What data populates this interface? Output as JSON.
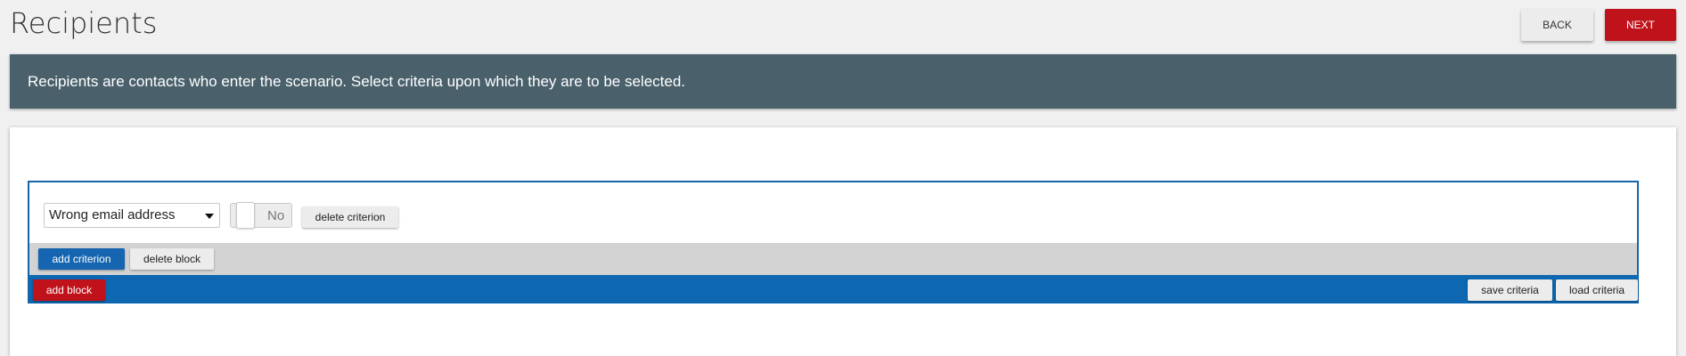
{
  "header": {
    "title": "Recipients",
    "back_label": "BACK",
    "next_label": "NEXT"
  },
  "banner": {
    "text": "Recipients are contacts who enter the scenario. Select criteria upon which they are to be selected."
  },
  "block": {
    "criterion": {
      "selected_value": "Wrong email address",
      "toggle_label": "No",
      "toggle_on": false,
      "delete_label": "delete criterion"
    },
    "actions": {
      "add_criterion_label": "add criterion",
      "delete_block_label": "delete block"
    }
  },
  "footer": {
    "add_block_label": "add block",
    "save_criteria_label": "save criteria",
    "load_criteria_label": "load criteria"
  },
  "colors": {
    "accent_red": "#c0121b",
    "accent_blue": "#1565b0",
    "banner_bg": "#4a616c"
  }
}
